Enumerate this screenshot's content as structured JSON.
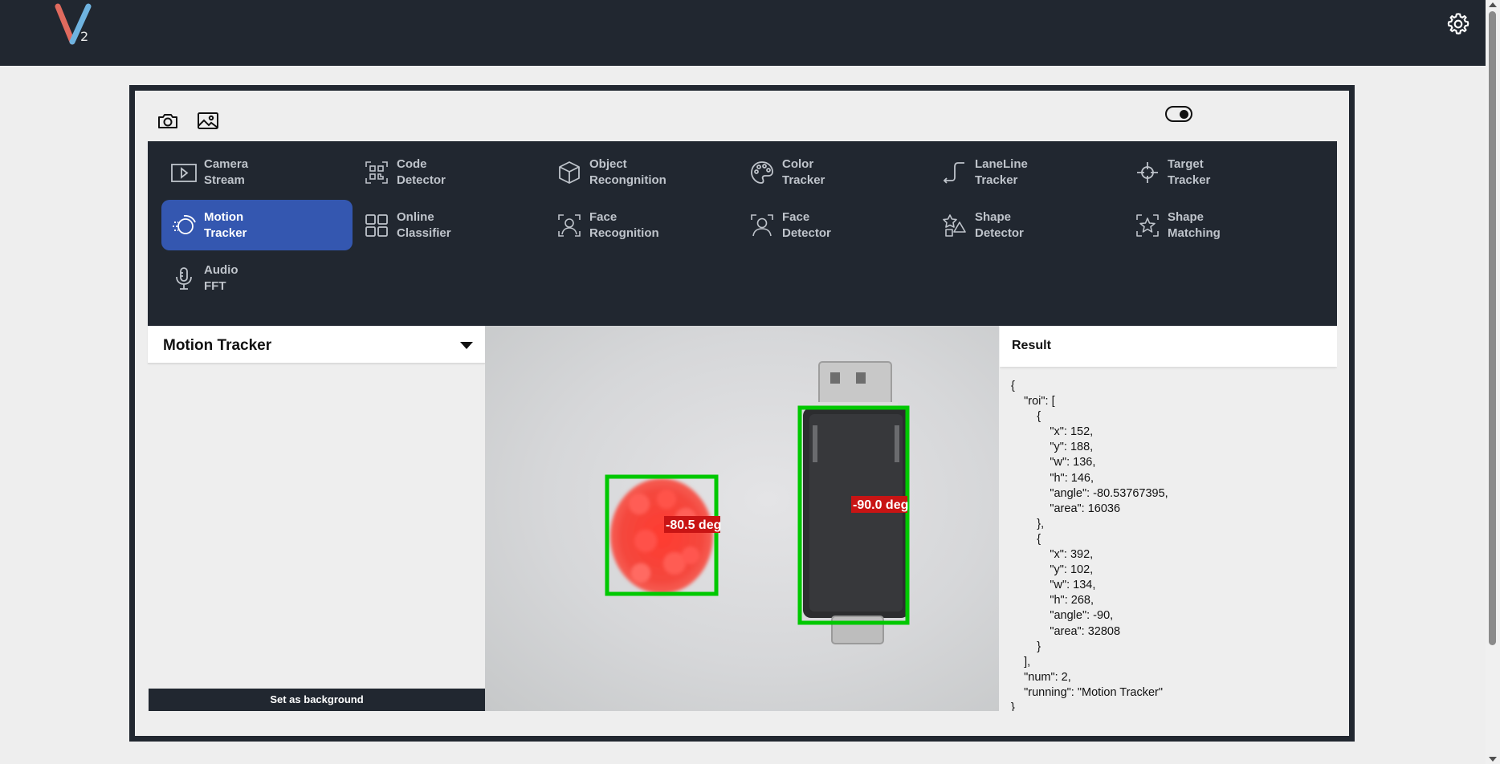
{
  "app": {
    "logo_text": "V",
    "logo_subscript": "2"
  },
  "menu": {
    "items": [
      {
        "label": "Camera\nStream",
        "icon": "play-box-icon",
        "active": false
      },
      {
        "label": "Code\nDetector",
        "icon": "qr-code-icon",
        "active": false
      },
      {
        "label": "Object\nRecongnition",
        "icon": "cube-icon",
        "active": false
      },
      {
        "label": "Color\nTracker",
        "icon": "palette-icon",
        "active": false
      },
      {
        "label": "LaneLine\nTracker",
        "icon": "lane-line-icon",
        "active": false
      },
      {
        "label": "Target\nTracker",
        "icon": "crosshair-icon",
        "active": false
      },
      {
        "label": "Motion\nTracker",
        "icon": "motion-icon",
        "active": true
      },
      {
        "label": "Online\nClassifier",
        "icon": "grid-icon",
        "active": false
      },
      {
        "label": "Face\nRecognition",
        "icon": "face-scan-icon",
        "active": false
      },
      {
        "label": "Face\nDetector",
        "icon": "face-icon",
        "active": false
      },
      {
        "label": "Shape\nDetector",
        "icon": "shapes-icon",
        "active": false
      },
      {
        "label": "Shape\nMatching",
        "icon": "star-scan-icon",
        "active": false
      },
      {
        "label": "Audio\nFFT",
        "icon": "microphone-icon",
        "active": false
      }
    ]
  },
  "left_panel": {
    "title": "Motion Tracker",
    "button_label": "Set as background"
  },
  "camera": {
    "labels": [
      "-80.5 deg",
      "-90.0 deg"
    ]
  },
  "result": {
    "title": "Result",
    "json_text": "{\n    \"roi\": [\n        {\n            \"x\": 152,\n            \"y\": 188,\n            \"w\": 136,\n            \"h\": 146,\n            \"angle\": -80.53767395,\n            \"area\": 16036\n        },\n        {\n            \"x\": 392,\n            \"y\": 102,\n            \"w\": 134,\n            \"h\": 268,\n            \"angle\": -90,\n            \"area\": 32808\n        }\n    ],\n    \"num\": 2,\n    \"running\": \"Motion Tracker\"\n}"
  },
  "colors": {
    "topbar": "#212730",
    "active_menu": "#3457b0",
    "detection_box": "#00c800",
    "label_bg": "#c81414"
  }
}
